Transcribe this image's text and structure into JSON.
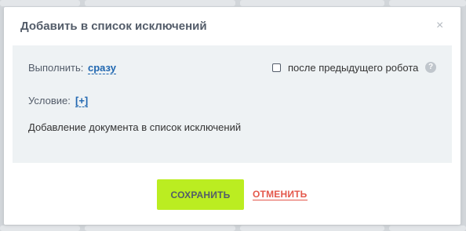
{
  "dialog": {
    "title": "Добавить в список исключений",
    "close_glyph": "×"
  },
  "execute": {
    "label": "Выполнить:",
    "value": "сразу"
  },
  "after_previous": {
    "checked": false,
    "label": "после предыдущего робота",
    "help_glyph": "?"
  },
  "condition": {
    "label": "Условие:",
    "value": "[+]"
  },
  "description": "Добавление документа в список исключений",
  "actions": {
    "save_label": "СОХРАНИТЬ",
    "cancel_label": "ОТМЕНИТЬ"
  },
  "colors": {
    "save_button": "#bbed21",
    "cancel_link": "#e4584b",
    "link": "#2067b0",
    "panel": "#eef2f4"
  },
  "icons": [
    "close-icon",
    "help-icon"
  ]
}
